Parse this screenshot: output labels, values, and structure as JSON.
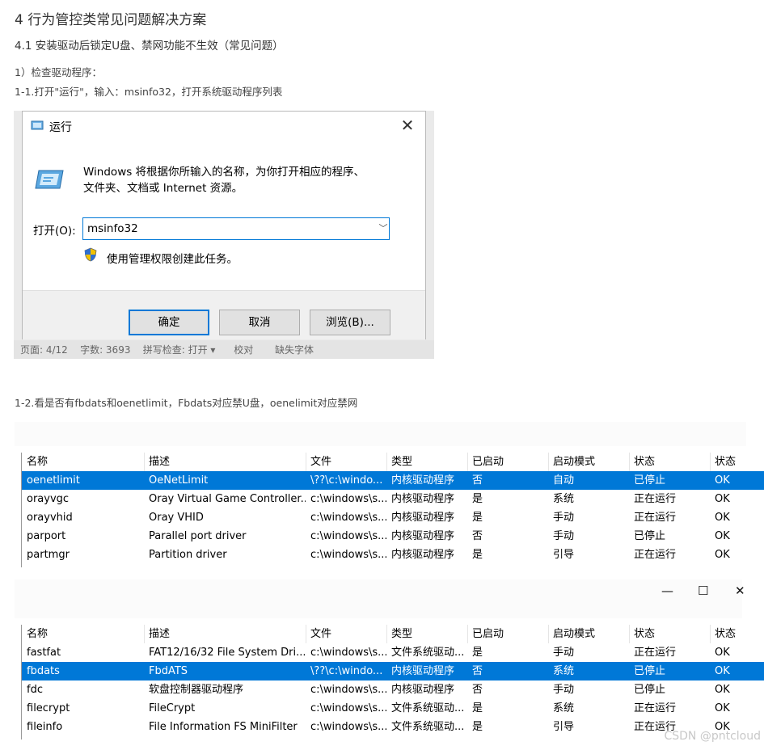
{
  "doc": {
    "h1": "4 行为管控类常见问题解决方案",
    "h2": "4.1 安装驱动后锁定U盘、禁网功能不生效（常见问题）",
    "p1": "1）检查驱动程序：",
    "p2": "1-1.打开\"运行\"，输入：msinfo32，打开系统驱动程序列表",
    "p3": "1-2.看是否有fbdats和oenetlimit，Fbdats对应禁U盘，oenelimit对应禁网",
    "watermark": "CSDN @pntcloud"
  },
  "run_dialog": {
    "title": "运行",
    "description_line1": "Windows 将根据你所输入的名称，为你打开相应的程序、",
    "description_line2": "文件夹、文档或 Internet 资源。",
    "open_label": "打开(O):",
    "open_value": "msinfo32",
    "admin_note": "使用管理权限创建此任务。",
    "ok_label": "确定",
    "cancel_label": "取消",
    "browse_label": "浏览(B)...",
    "behind_status": "页面: 4/12    字数: 3693    拼写检查: 打开 ▾      校对       缺失字体"
  },
  "table1": {
    "columns": [
      "名称",
      "描述",
      "文件",
      "类型",
      "已启动",
      "启动模式",
      "状态",
      "状态"
    ],
    "rows": [
      [
        "oenetlimit",
        "OeNetLimit",
        "\\??\\c:\\windo...",
        "内核驱动程序",
        "否",
        "自动",
        "已停止",
        "OK"
      ],
      [
        "orayvgc",
        "Oray Virtual Game Controller...",
        "c:\\windows\\s...",
        "内核驱动程序",
        "是",
        "系统",
        "正在运行",
        "OK"
      ],
      [
        "orayvhid",
        "Oray VHID",
        "c:\\windows\\s...",
        "内核驱动程序",
        "是",
        "手动",
        "正在运行",
        "OK"
      ],
      [
        "parport",
        "Parallel port driver",
        "c:\\windows\\s...",
        "内核驱动程序",
        "否",
        "手动",
        "已停止",
        "OK"
      ],
      [
        "partmgr",
        "Partition driver",
        "c:\\windows\\s...",
        "内核驱动程序",
        "是",
        "引导",
        "正在运行",
        "OK"
      ]
    ],
    "selected_row": 0
  },
  "table2": {
    "window_controls": [
      "—",
      "☐",
      "✕"
    ],
    "columns": [
      "名称",
      "描述",
      "文件",
      "类型",
      "已启动",
      "启动模式",
      "状态",
      "状态"
    ],
    "rows": [
      [
        "fastfat",
        "FAT12/16/32 File System Dri...",
        "c:\\windows\\s...",
        "文件系统驱动...",
        "是",
        "手动",
        "正在运行",
        "OK"
      ],
      [
        "fbdats",
        "FbdATS",
        "\\??\\c:\\windo...",
        "内核驱动程序",
        "否",
        "系统",
        "已停止",
        "OK"
      ],
      [
        "fdc",
        "软盘控制器驱动程序",
        "c:\\windows\\s...",
        "内核驱动程序",
        "否",
        "手动",
        "已停止",
        "OK"
      ],
      [
        "filecrypt",
        "FileCrypt",
        "c:\\windows\\s...",
        "文件系统驱动...",
        "是",
        "系统",
        "正在运行",
        "OK"
      ],
      [
        "fileinfo",
        "File Information FS MiniFilter",
        "c:\\windows\\s...",
        "文件系统驱动...",
        "是",
        "引导",
        "正在运行",
        "OK"
      ]
    ],
    "selected_row": 1
  },
  "colors": {
    "selection": "#0078d7",
    "accent": "#0078d7"
  }
}
